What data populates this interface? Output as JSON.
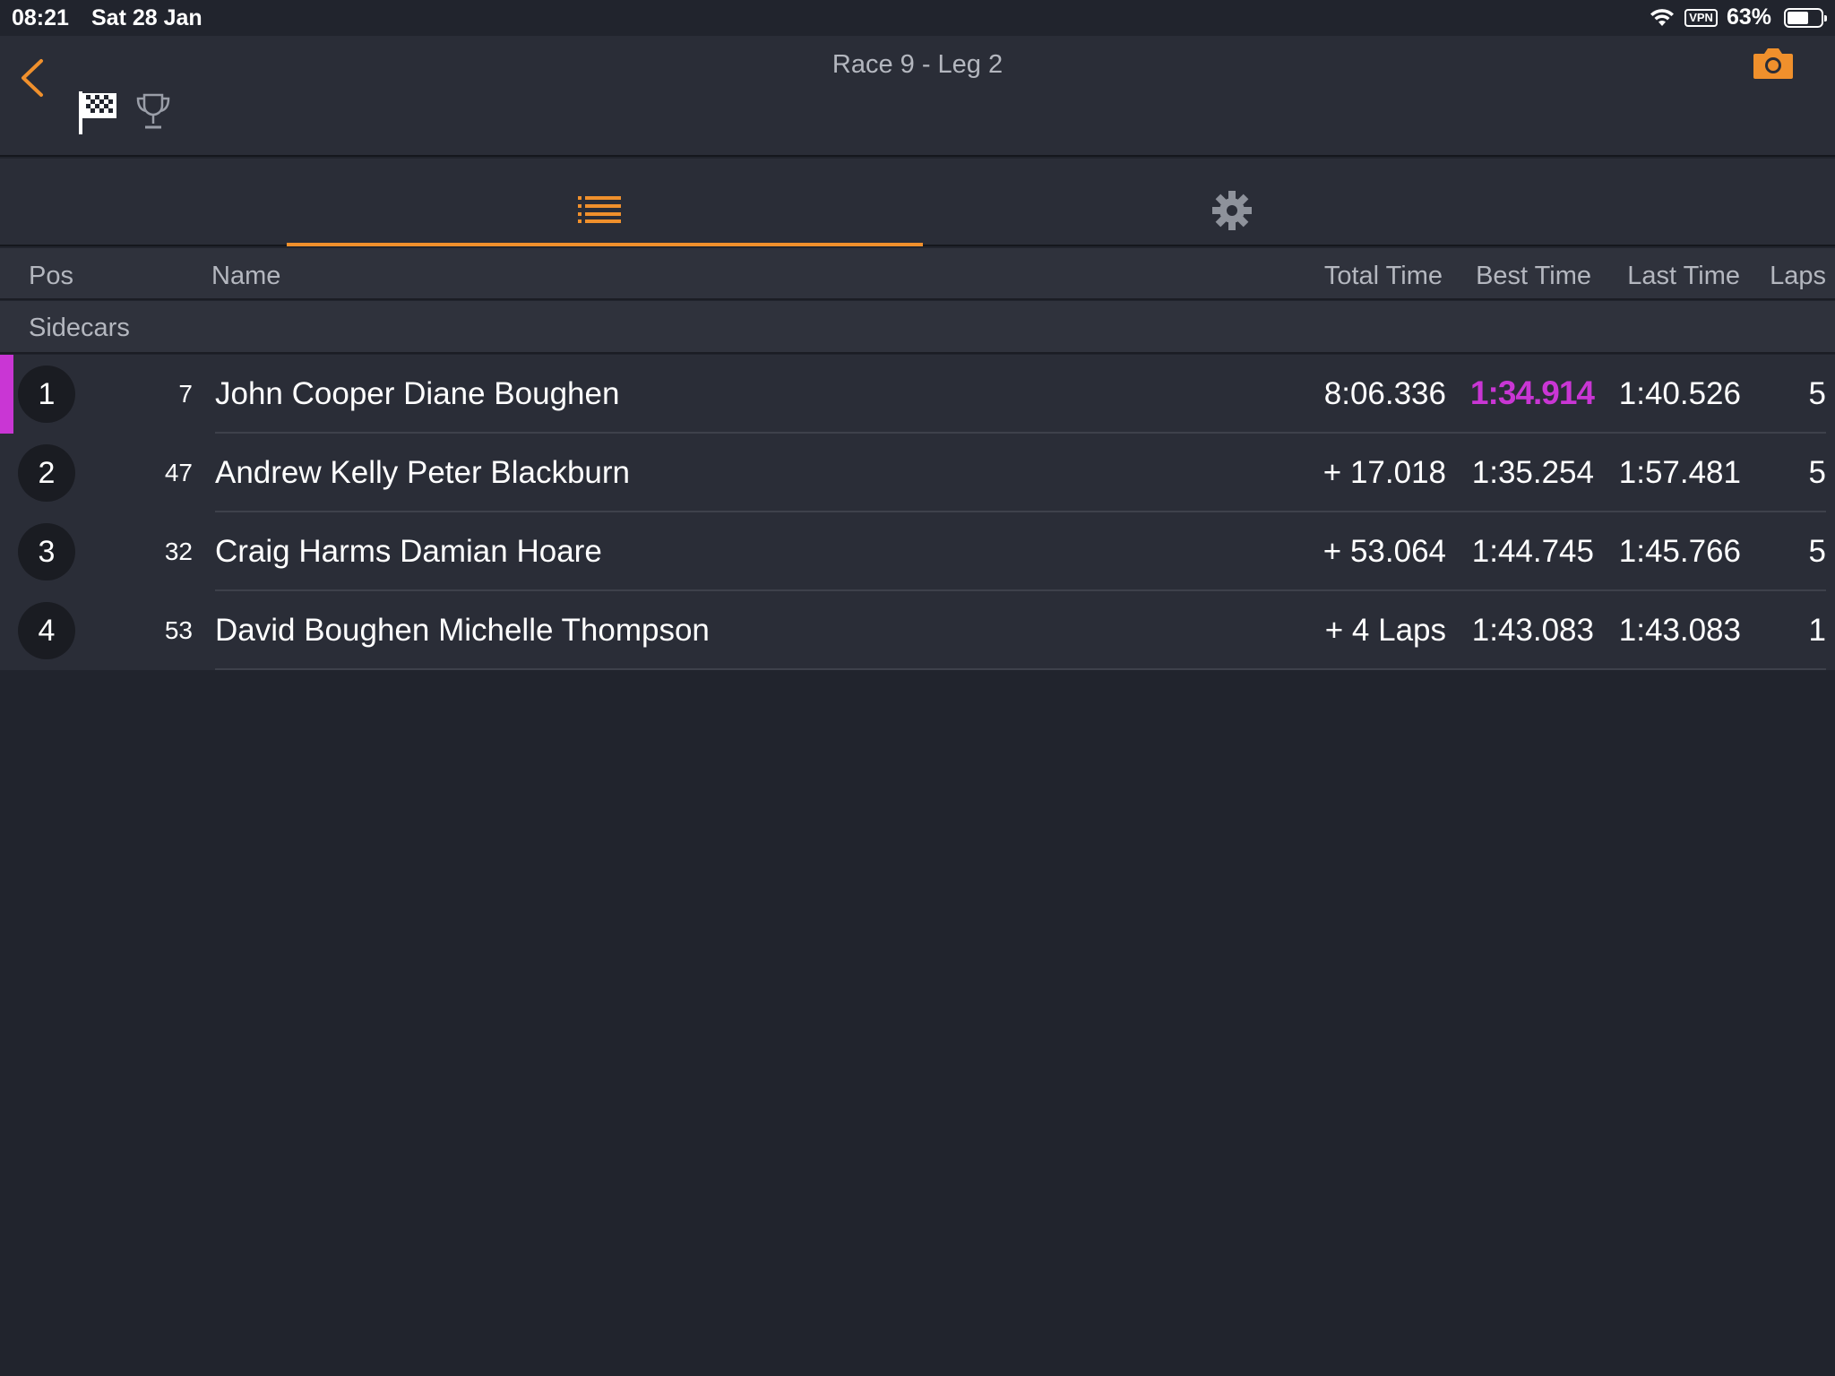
{
  "status_bar": {
    "time": "08:21",
    "date": "Sat 28 Jan",
    "vpn": "VPN",
    "battery": "63%",
    "battery_level": 0.63
  },
  "nav": {
    "title": "Race 9 - Leg 2",
    "accent_color": "#f0902c"
  },
  "tabs": [
    {
      "icon": "list-icon",
      "active": true
    },
    {
      "icon": "gear-icon",
      "active": false
    }
  ],
  "columns": {
    "pos": "Pos",
    "name": "Name",
    "total": "Total Time",
    "best": "Best Time",
    "last": "Last Time",
    "laps": "Laps"
  },
  "group": "Sidecars",
  "fastest_color": "#c936d4",
  "results": [
    {
      "pos": "1",
      "num": "7",
      "name": "John Cooper Diane Boughen",
      "total": "8:06.336",
      "best": "1:34.914",
      "last": "1:40.526",
      "laps": "5"
    },
    {
      "pos": "2",
      "num": "47",
      "name": "Andrew Kelly Peter Blackburn",
      "total": "+ 17.018",
      "best": "1:35.254",
      "last": "1:57.481",
      "laps": "5"
    },
    {
      "pos": "3",
      "num": "32",
      "name": "Craig Harms Damian Hoare",
      "total": "+ 53.064",
      "best": "1:44.745",
      "last": "1:45.766",
      "laps": "5"
    },
    {
      "pos": "4",
      "num": "53",
      "name": "David Boughen Michelle Thompson",
      "total": "+ 4 Laps",
      "best": "1:43.083",
      "last": "1:43.083",
      "laps": "1"
    }
  ]
}
